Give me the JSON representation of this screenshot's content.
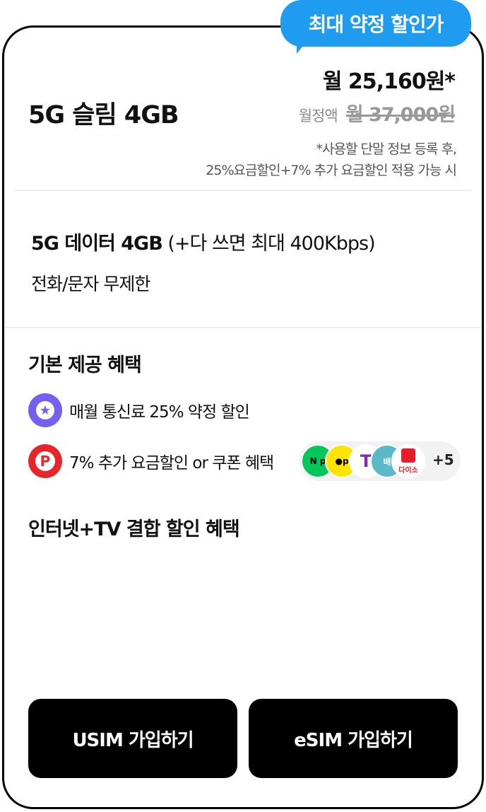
{
  "badge": {
    "label": "최대 약정 할인가"
  },
  "plan": {
    "name": "5G 슬림 4GB",
    "discounted_price": "월 25,160원*",
    "original_label": "월정액",
    "original_price": "월 37,000원",
    "note_line1": "*사용할 단말 정보 등록 후,",
    "note_line2": "25%요금할인+7% 추가 요금할인 적용 가능 시"
  },
  "specs": {
    "data_bold": "5G 데이터 4GB",
    "data_extra": " (+다 쓰면 최대 400Kbps)",
    "calls": "전화/문자 무제한"
  },
  "benefits": {
    "title": "기본 제공 혜택",
    "items": [
      {
        "icon": "star-icon",
        "label": "매월 통신료 25% 약정 할인"
      },
      {
        "icon": "p-point-icon",
        "label": "7% 추가 요금할인 or 쿠폰 혜택"
      }
    ],
    "partner_logos": {
      "naver_pay": "N p",
      "kakao_pay": "●p",
      "t_logo": "T",
      "baemin": "배",
      "daiso": "다이소",
      "more": "+5"
    }
  },
  "combo": {
    "title": "인터넷+TV 결합 할인 혜택"
  },
  "buttons": {
    "usim": "USIM 가입하기",
    "esim": "eSIM 가입하기"
  },
  "colors": {
    "badge": "#1f9bf0",
    "star_icon": "#7360f2",
    "p_icon": "#e8252b",
    "button": "#000000"
  }
}
